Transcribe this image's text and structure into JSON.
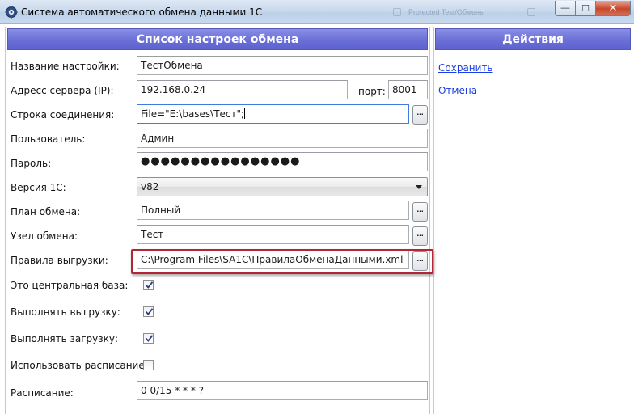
{
  "window": {
    "title": "Система автоматического обмена данными 1С",
    "ghost_text": "Protected   Test/Обмены",
    "buttons": {
      "minimize": "—",
      "maximize": "☐",
      "close": "✕"
    }
  },
  "left_panel": {
    "header": "Список настроек обмена"
  },
  "right_panel": {
    "header": "Действия",
    "actions": {
      "save": "Сохранить",
      "cancel": "Отмена"
    }
  },
  "form": {
    "name": {
      "label": "Название настройки:",
      "value": "ТестОбмена"
    },
    "server": {
      "label": "Адресс сервера (IP):",
      "value": "192.168.0.24",
      "port_label": "порт:",
      "port_value": "8001"
    },
    "connection": {
      "label": "Строка соединения:",
      "value": "File=\"E:\\bases\\Тест\";",
      "button": "..."
    },
    "user": {
      "label": "Пользователь:",
      "value": "Админ"
    },
    "password": {
      "label": "Пароль:",
      "value": "●●●●●●●●●●●●●●●●"
    },
    "version": {
      "label": "Версия 1С:",
      "value": "v82"
    },
    "plan": {
      "label": "План обмена:",
      "value": "Полный",
      "button": "..."
    },
    "node": {
      "label": "Узел обмена:",
      "value": "Тест",
      "button": "..."
    },
    "rules": {
      "label": "Правила выгрузки:",
      "value": "C:\\Program Files\\SA1C\\ПравилаОбменаДанными.xml",
      "button": "..."
    },
    "central": {
      "label": "Это центральная база:",
      "checked": true
    },
    "export": {
      "label": "Выполнять выгрузку:",
      "checked": true
    },
    "import": {
      "label": "Выполнять загрузку:",
      "checked": true
    },
    "use_schedule": {
      "label": "Использовать расписание:",
      "checked": false
    },
    "schedule": {
      "label": "Расписание:",
      "value": "0 0/15 * * * ?"
    }
  },
  "colors": {
    "header_bg": "#6d72d8",
    "highlight_border": "#b32435",
    "link": "#1a3ee0"
  }
}
